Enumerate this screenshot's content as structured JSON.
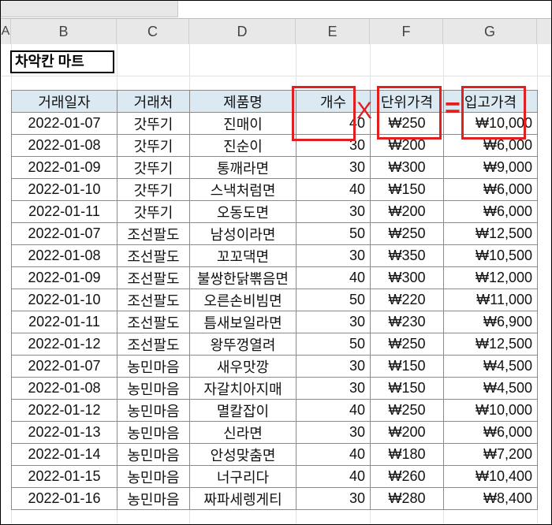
{
  "columns": [
    "A",
    "B",
    "C",
    "D",
    "E",
    "F",
    "G"
  ],
  "store_title": "차악칸 마트",
  "table": {
    "headers": [
      "거래일자",
      "거래처",
      "제품명",
      "개수",
      "단위가격",
      "입고가격"
    ],
    "rows": [
      [
        "2022-01-07",
        "갓뚜기",
        "진매이",
        "40",
        "₩250",
        "₩10,000"
      ],
      [
        "2022-01-08",
        "갓뚜기",
        "진순이",
        "30",
        "₩200",
        "₩6,000"
      ],
      [
        "2022-01-09",
        "갓뚜기",
        "통깨라면",
        "30",
        "₩300",
        "₩9,000"
      ],
      [
        "2022-01-10",
        "갓뚜기",
        "스낵처럼면",
        "40",
        "₩150",
        "₩6,000"
      ],
      [
        "2022-01-11",
        "갓뚜기",
        "오동도면",
        "30",
        "₩200",
        "₩6,000"
      ],
      [
        "2022-01-07",
        "조선팔도",
        "남성이라면",
        "50",
        "₩250",
        "₩12,500"
      ],
      [
        "2022-01-08",
        "조선팔도",
        "꼬꼬댁면",
        "30",
        "₩350",
        "₩10,500"
      ],
      [
        "2022-01-09",
        "조선팔도",
        "불쌍한닭뽂음면",
        "40",
        "₩300",
        "₩12,000"
      ],
      [
        "2022-01-10",
        "조선팔도",
        "오른손비빔면",
        "50",
        "₩220",
        "₩11,000"
      ],
      [
        "2022-01-11",
        "조선팔도",
        "틈새보일라면",
        "30",
        "₩230",
        "₩6,900"
      ],
      [
        "2022-01-12",
        "조선팔도",
        "왕뚜껑열려",
        "50",
        "₩250",
        "₩12,500"
      ],
      [
        "2022-01-07",
        "농민마음",
        "새우맛깡",
        "30",
        "₩150",
        "₩4,500"
      ],
      [
        "2022-01-08",
        "농민마음",
        "자갈치아지매",
        "30",
        "₩150",
        "₩4,500"
      ],
      [
        "2022-01-12",
        "농민마음",
        "멸칼잡이",
        "40",
        "₩250",
        "₩10,000"
      ],
      [
        "2022-01-13",
        "농민마음",
        "신라면",
        "30",
        "₩200",
        "₩6,000"
      ],
      [
        "2022-01-14",
        "농민마음",
        "안성맞춤면",
        "40",
        "₩180",
        "₩7,200"
      ],
      [
        "2022-01-15",
        "농민마음",
        "너구리다",
        "40",
        "₩260",
        "₩10,400"
      ],
      [
        "2022-01-16",
        "농민마음",
        "짜파세렝게티",
        "30",
        "₩280",
        "₩8,400"
      ]
    ]
  },
  "annotations": {
    "multiply": "X",
    "equals": "="
  },
  "colors": {
    "header_fill": "#dbe9f3",
    "annotation_red": "#e02020"
  }
}
